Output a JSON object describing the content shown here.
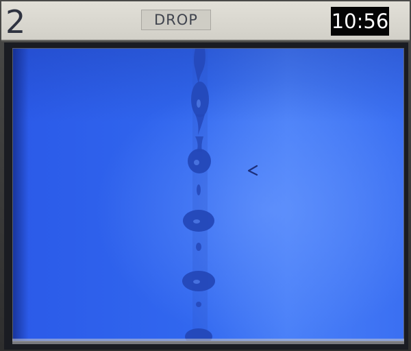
{
  "header": {
    "channel_number": "2",
    "mode_label": "DROP",
    "clock": "10:56"
  },
  "video": {
    "background_color": "#2f63ee",
    "drop_color": "#2448b8",
    "marker_icon": "chevron-left-icon"
  }
}
